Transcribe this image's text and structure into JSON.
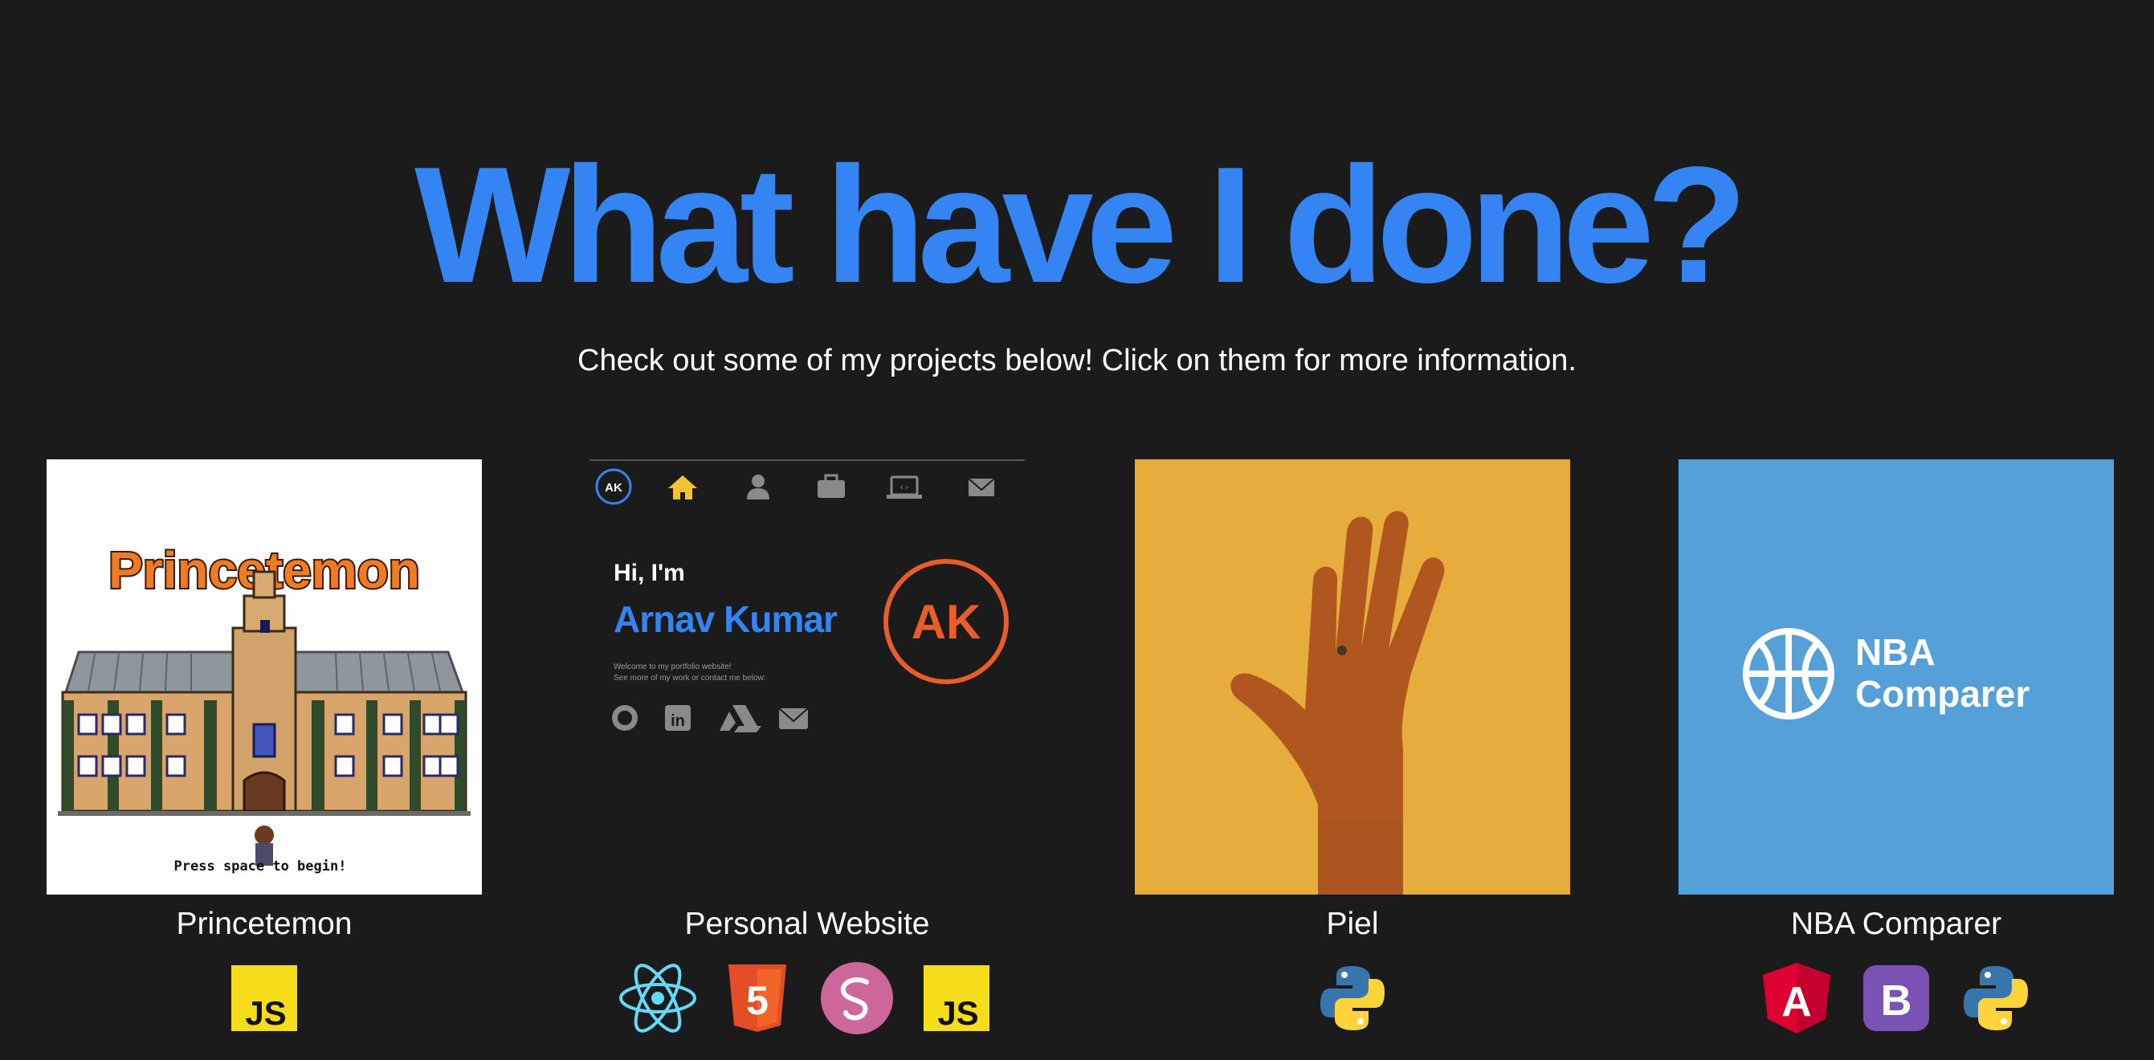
{
  "header": {
    "title": "What have I done?",
    "subtitle": "Check out some of my projects below! Click on them for more information."
  },
  "colors": {
    "background": "#1b1b1b",
    "accent": "#3485f3",
    "ak_orange": "#e85d2a",
    "piel_yellow": "#e6ac3c",
    "nba_blue": "#55a0d8"
  },
  "projects": [
    {
      "name": "Princetemon",
      "thumb": {
        "logo_text": "Princetemon",
        "caption": "Press space to begin!"
      },
      "tech_icons": [
        "javascript-icon"
      ]
    },
    {
      "name": "Personal Website",
      "thumb": {
        "nav_badge": "AK",
        "greeting": "Hi, I'm",
        "person_name": "Arnav Kumar",
        "welcome_line1": "Welcome to my portfolio website!",
        "welcome_line2": "See more of my work or contact me below:",
        "avatar_initials": "AK"
      },
      "tech_icons": [
        "react-icon",
        "html5-icon",
        "sass-icon",
        "javascript-icon"
      ]
    },
    {
      "name": "Piel",
      "thumb": {},
      "tech_icons": [
        "python-icon"
      ]
    },
    {
      "name": "NBA Comparer",
      "thumb": {
        "logo_line1": "NBA",
        "logo_line2": "Comparer"
      },
      "tech_icons": [
        "angular-icon",
        "bootstrap-icon",
        "python-icon"
      ]
    }
  ],
  "tech_labels": {
    "js": "JS",
    "html5": "5",
    "bootstrap": "B",
    "angular": "A"
  }
}
